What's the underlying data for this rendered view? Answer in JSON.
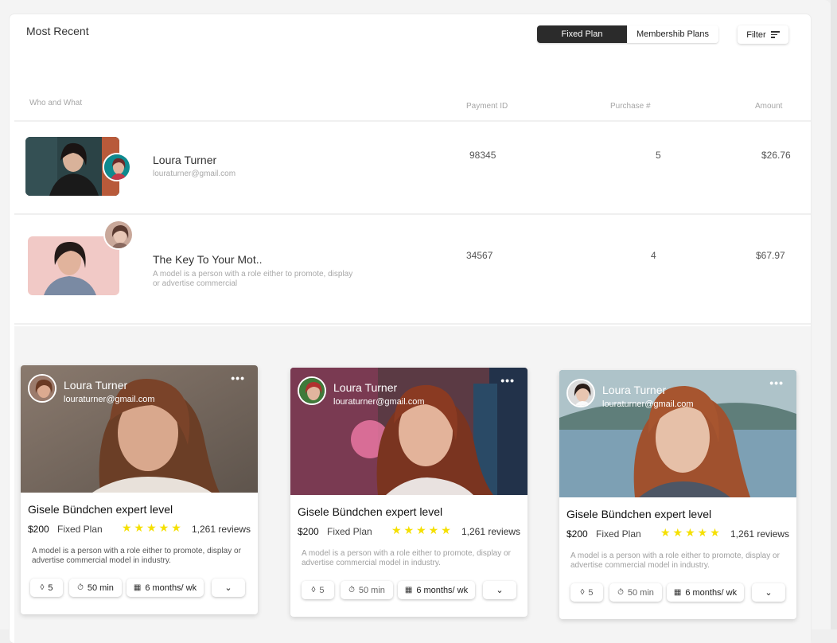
{
  "header": {
    "title": "Most Recent",
    "plan_fixed": "Fixed Plan",
    "plan_membership": "Membershib Plans",
    "filter_label": "Filter"
  },
  "table": {
    "columns": [
      "Who and What",
      "Payment ID",
      "Purchase #",
      "Amount"
    ],
    "rows": [
      {
        "name": "Loura Turner",
        "sub": "louraturner@gmail.com",
        "payment_id": "98345",
        "purchase": "5",
        "amount": "$26.76"
      },
      {
        "name": "The Key To Your Mot..",
        "sub": "A model is a person with a role either to promote, display or advertise commercial",
        "payment_id": "34567",
        "purchase": "4",
        "amount": "$67.97"
      }
    ]
  },
  "cards": [
    {
      "name": "Loura Turner",
      "email": "louraturner@gmail.com",
      "more": "•••",
      "title": "Gisele Bündchen expert level",
      "price": "$200",
      "plan": "Fixed Plan",
      "stars": "★★★★★",
      "reviews": "1,261 reviews",
      "desc": "A model is a person with a role either to promote, display or advertise commercial model in industry.",
      "chip1": "5",
      "chip2": "50 min",
      "chip3": "6 months/ wk",
      "chip4": "⌄"
    },
    {
      "name": "Loura Turner",
      "email": "louraturner@gmail.com",
      "more": "•••",
      "title": "Gisele Bündchen expert level",
      "price": "$200",
      "plan": "Fixed Plan",
      "stars": "★★★★★",
      "reviews": "1,261 reviews",
      "desc": "A model is a person with a role either to promote, display or advertise commercial model in industry.",
      "chip1": "5",
      "chip2": "50 min",
      "chip3": "6 months/ wk",
      "chip4": "⌄"
    },
    {
      "name": "Loura Turner",
      "email": "louraturner@gmail.com",
      "more": "•••",
      "title": "Gisele Bündchen expert level",
      "price": "$200",
      "plan": "Fixed Plan",
      "stars": "★★★★★",
      "reviews": "1,261 reviews",
      "desc": "A model is a person with a role either to promote, display or advertise commercial model in industry.",
      "chip1": "5",
      "chip2": "50 min",
      "chip3": "6 months/ wk",
      "chip4": "⌄"
    }
  ],
  "icons": {
    "filter": "filter-lines-icon",
    "purchase": "tag-icon",
    "duration": "timer-icon",
    "schedule": "calendar-icon",
    "expand": "chevron-down-icon",
    "more": "more-horizontal-icon"
  },
  "colors": {
    "accent_dark": "#2b2b2b",
    "star": "#f5e000",
    "muted": "#a6a6a6"
  }
}
